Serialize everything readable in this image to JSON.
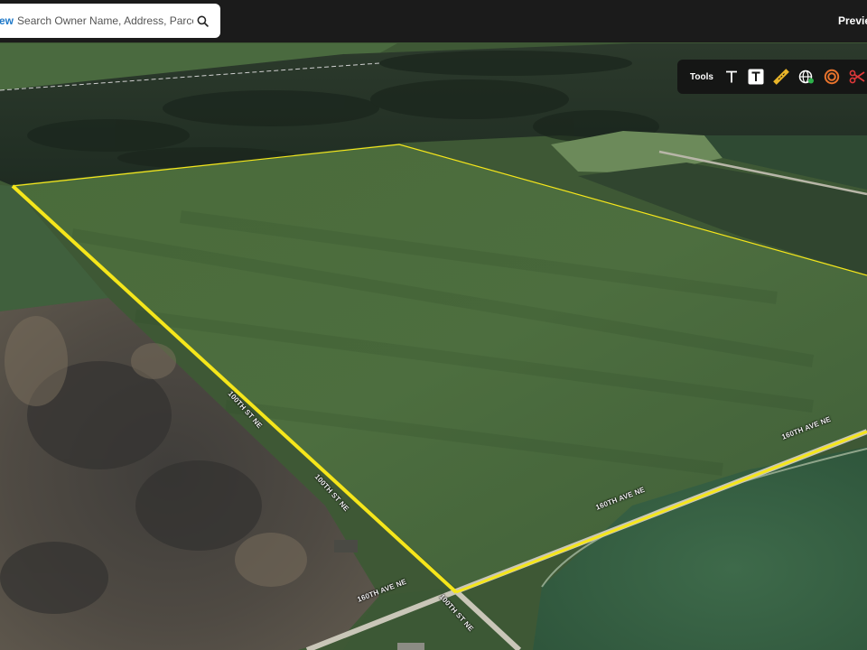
{
  "search": {
    "view_label": "ew",
    "placeholder": "Search Owner Name, Address, Parcel Id"
  },
  "header": {
    "preview_label": "Preview"
  },
  "toolbar": {
    "label": "Tools",
    "tools": [
      {
        "name": "text-icon",
        "color": "#ffffff"
      },
      {
        "name": "text-box-icon",
        "color": "#ffffff"
      },
      {
        "name": "ruler-icon",
        "color": "#e8b429"
      },
      {
        "name": "globe-pin-icon",
        "color": "#ffffff"
      },
      {
        "name": "buffer-ring-icon",
        "color": "#e8732c"
      },
      {
        "name": "scissors-icon",
        "color": "#e0383a"
      }
    ]
  },
  "roads": {
    "ave_label_left": "160TH AVE NE",
    "ave_label_mid": "160TH AVE NE",
    "ave_label_right": "160TH AVE NE",
    "st_label_bottom": "100TH ST NE",
    "st_label_mid": "100TH ST NE",
    "st_label_upper": "100TH ST NE"
  },
  "colors": {
    "parcel_outline": "#f5e61b",
    "toolbar_bg": "#141414",
    "header_bg": "#1b1b1b",
    "accent": "#1e78c8"
  }
}
